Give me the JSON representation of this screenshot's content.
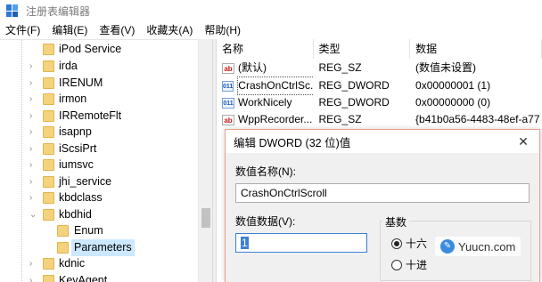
{
  "window": {
    "title": "注册表编辑器"
  },
  "menu": [
    {
      "label": "文件(F)"
    },
    {
      "label": "编辑(E)"
    },
    {
      "label": "查看(V)"
    },
    {
      "label": "收藏夹(A)"
    },
    {
      "label": "帮助(H)"
    }
  ],
  "tree": {
    "items": [
      {
        "label": "iPod Service"
      },
      {
        "label": "irda"
      },
      {
        "label": "IRENUM"
      },
      {
        "label": "irmon"
      },
      {
        "label": "IRRemoteFlt"
      },
      {
        "label": "isapnp"
      },
      {
        "label": "iScsiPrt"
      },
      {
        "label": "iumsvc"
      },
      {
        "label": "jhi_service"
      },
      {
        "label": "kbdclass"
      },
      {
        "label": "kbdhid"
      },
      {
        "label": "Enum"
      },
      {
        "label": "Parameters"
      },
      {
        "label": "kdnic"
      },
      {
        "label": "KeyAgent"
      }
    ]
  },
  "list": {
    "headers": {
      "name": "名称",
      "type": "类型",
      "data": "数据"
    },
    "rows": [
      {
        "icon": "string-value-icon",
        "name": "(默认)",
        "type": "REG_SZ",
        "data": "(数值未设置)"
      },
      {
        "icon": "binary-value-icon",
        "name": "CrashOnCtrlSc...",
        "type": "REG_DWORD",
        "data": "0x00000001 (1)"
      },
      {
        "icon": "binary-value-icon",
        "name": "WorkNicely",
        "type": "REG_DWORD",
        "data": "0x00000000 (0)"
      },
      {
        "icon": "string-value-icon",
        "name": "WppRecorder...",
        "type": "REG_SZ",
        "data": "{b41b0a56-4483-48ef-a77"
      }
    ]
  },
  "dialog": {
    "title": "编辑 DWORD (32 位)值",
    "value_name_label": "数值名称(N):",
    "value_name": "CrashOnCtrlScroll",
    "value_data_label": "数值数据(V):",
    "value_data": "1",
    "base_label": "基数",
    "base_hex": "十六",
    "base_dec": "十进",
    "selected_base": "hex"
  },
  "watermark": {
    "text": "Yuucn.com"
  },
  "colors": {
    "selection": "#3f7ed8",
    "tree_selected_bg": "#cce8ff",
    "folder": "#f4d27e"
  }
}
